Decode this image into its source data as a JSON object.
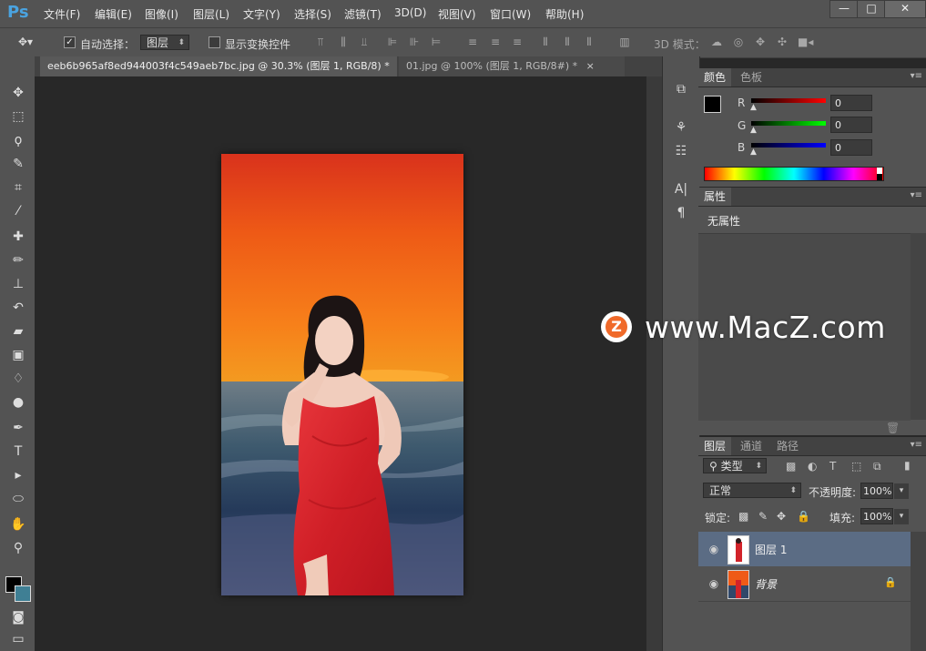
{
  "app": {
    "logo": "Ps"
  },
  "menu": [
    "文件(F)",
    "编辑(E)",
    "图像(I)",
    "图层(L)",
    "文字(Y)",
    "选择(S)",
    "滤镜(T)",
    "3D(D)",
    "视图(V)",
    "窗口(W)",
    "帮助(H)"
  ],
  "window_controls": {
    "minimize": "—",
    "maximize": "□",
    "close": "✕"
  },
  "options": {
    "auto_select_label": "自动选择：",
    "auto_select_checked": "✓",
    "target_value": "图层",
    "show_transform_label": "显示变换控件",
    "mode_3d_label": "3D 模式："
  },
  "tabs": [
    {
      "label": "eeb6b965af8ed944003f4c549aeb7bc.jpg @ 30.3% (图层 1, RGB/8) *",
      "close": "×"
    },
    {
      "label": "01.jpg @ 100% (图层 1, RGB/8#) *",
      "close": "×"
    }
  ],
  "color_panel": {
    "tabs": [
      "颜色",
      "色板"
    ],
    "r_label": "R",
    "g_label": "G",
    "b_label": "B",
    "r_value": "0",
    "g_value": "0",
    "b_value": "0",
    "foreground": "#000000",
    "background": "#3f7f94"
  },
  "properties_panel": {
    "tab": "属性",
    "content": "无属性"
  },
  "layers_panel": {
    "tabs": [
      "图层",
      "通道",
      "路径"
    ],
    "filter_label": "类型",
    "blend_mode": "正常",
    "opacity_label": "不透明度:",
    "opacity_value": "100%",
    "lock_label": "锁定:",
    "fill_label": "填充:",
    "fill_value": "100%",
    "layers": [
      {
        "name": "图层 1",
        "selected": true
      },
      {
        "name": "背景",
        "selected": false,
        "locked": true
      }
    ]
  },
  "watermark": {
    "badge": "Z",
    "text": "www.MacZ.com"
  },
  "icons": {
    "move": "move-icon",
    "marquee": "marquee-icon",
    "lasso": "lasso-icon",
    "quick-select": "quick-select-icon",
    "crop": "crop-icon",
    "eyedropper": "eyedropper-icon",
    "healing": "healing-icon",
    "brush": "brush-icon",
    "stamp": "stamp-icon",
    "history-brush": "history-brush-icon",
    "eraser": "eraser-icon",
    "gradient": "gradient-icon",
    "blur": "blur-icon",
    "dodge": "dodge-icon",
    "pen": "pen-icon",
    "type": "type-icon",
    "path-select": "path-select-icon",
    "shape": "shape-icon",
    "hand": "hand-icon",
    "zoom": "zoom-icon"
  }
}
